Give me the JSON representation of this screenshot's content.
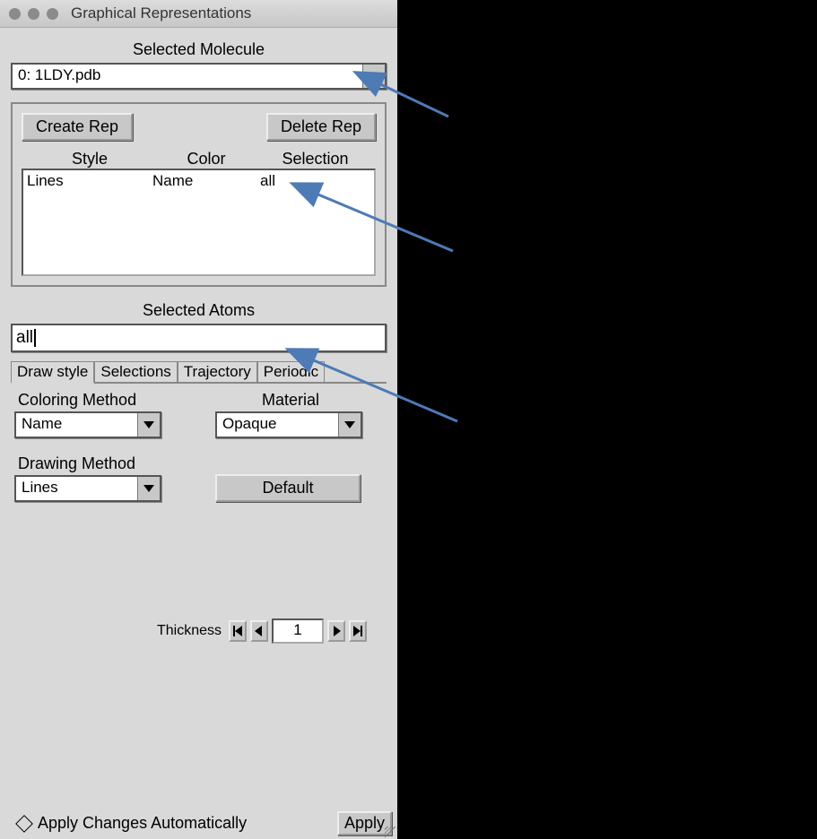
{
  "window": {
    "title": "Graphical Representations"
  },
  "selected_molecule": {
    "label": "Selected Molecule",
    "value": "0: 1LDY.pdb"
  },
  "rep_buttons": {
    "create": "Create Rep",
    "delete": "Delete Rep"
  },
  "rep_list": {
    "headers": {
      "style": "Style",
      "color": "Color",
      "selection": "Selection"
    },
    "rows": [
      {
        "style": "Lines",
        "color": "Name",
        "selection": "all"
      }
    ]
  },
  "selected_atoms": {
    "label": "Selected Atoms",
    "value": "all"
  },
  "tabs": {
    "draw": "Draw style",
    "selections": "Selections",
    "trajectory": "Trajectory",
    "periodic": "Periodic"
  },
  "coloring": {
    "label": "Coloring Method",
    "value": "Name"
  },
  "material": {
    "label": "Material",
    "value": "Opaque"
  },
  "drawing": {
    "label": "Drawing Method",
    "value": "Lines"
  },
  "default_button": "Default",
  "thickness": {
    "label": "Thickness",
    "value": "1"
  },
  "footer": {
    "auto": "Apply Changes Automatically",
    "apply": "Apply"
  },
  "arrow_color": "#4e7ab5"
}
